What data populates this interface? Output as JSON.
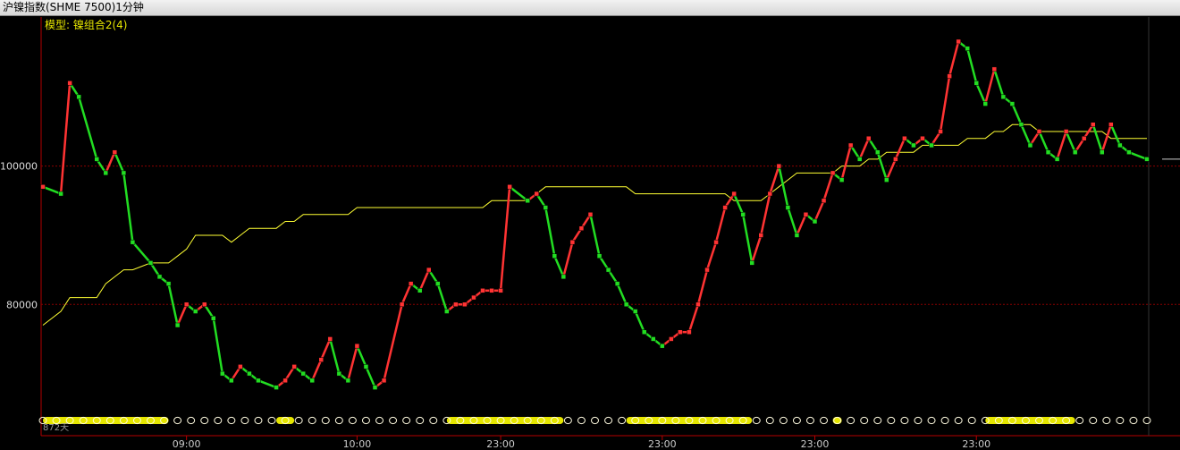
{
  "window": {
    "title": "沪镍指数(SHME 7500)1分钟"
  },
  "model_label": "模型: 镍组合2(4)",
  "colors": {
    "price": "#c8c8c8",
    "avg": "#ffff33",
    "up": "#ff3333",
    "down": "#22dd22",
    "gridline": "#8b0000",
    "axis": "#b40000",
    "signal": "#e6e600"
  },
  "chart_data": {
    "type": "line",
    "title": "沪镍指数(SHME 7500)1分钟",
    "ylim": [
      64000,
      120000
    ],
    "yticks": [
      80000,
      100000
    ],
    "ytick_labels": [
      "80000",
      "100000"
    ],
    "xticks": [
      16,
      35,
      51,
      69,
      86,
      104
    ],
    "xtick_labels": [
      "09:00",
      "10:00",
      "23:00",
      "23:00",
      "23:00",
      "23:00"
    ],
    "x": [
      0,
      2,
      3,
      4,
      6,
      7,
      8,
      9,
      10,
      12,
      13,
      14,
      15,
      16,
      17,
      18,
      19,
      20,
      21,
      22,
      23,
      24,
      26,
      27,
      28,
      29,
      30,
      31,
      32,
      33,
      34,
      35,
      36,
      37,
      38,
      40,
      41,
      42,
      43,
      44,
      45,
      46,
      47,
      48,
      49,
      50,
      51,
      52,
      54,
      55,
      56,
      57,
      58,
      59,
      60,
      61,
      62,
      63,
      64,
      65,
      66,
      67,
      68,
      69,
      70,
      71,
      72,
      73,
      74,
      75,
      76,
      77,
      78,
      79,
      80,
      81,
      82,
      83,
      84,
      85,
      86,
      87,
      88,
      89,
      90,
      91,
      92,
      93,
      94,
      95,
      96,
      97,
      98,
      99,
      100,
      101,
      102,
      103,
      104,
      105,
      106,
      107,
      108,
      109,
      110,
      111,
      112,
      113,
      114,
      115,
      116,
      117,
      118,
      119,
      120,
      121,
      123
    ],
    "series": [
      {
        "name": "",
        "values": [
          97000,
          96000,
          112000,
          110000,
          101000,
          99000,
          102000,
          99000,
          89000,
          86000,
          84000,
          83000,
          77000,
          80000,
          79000,
          80000,
          78000,
          70000,
          69000,
          71000,
          70000,
          69000,
          68000,
          69000,
          71000,
          70000,
          69000,
          72000,
          75000,
          70000,
          69000,
          74000,
          71000,
          68000,
          69000,
          80000,
          83000,
          82000,
          85000,
          83000,
          79000,
          80000,
          80000,
          81000,
          82000,
          82000,
          82000,
          97000,
          95000,
          96000,
          94000,
          87000,
          84000,
          89000,
          91000,
          93000,
          87000,
          85000,
          83000,
          80000,
          79000,
          76000,
          75000,
          74000,
          75000,
          76000,
          76000,
          80000,
          85000,
          89000,
          94000,
          96000,
          93000,
          86000,
          90000,
          96000,
          100000,
          94000,
          90000,
          93000,
          92000,
          95000,
          99000,
          98000,
          103000,
          101000,
          104000,
          102000,
          98000,
          101000,
          104000,
          103000,
          104000,
          103000,
          105000,
          113000,
          118000,
          117000,
          112000,
          109000,
          114000,
          110000,
          109000,
          106000,
          103000,
          105000,
          102000,
          101000,
          105000,
          102000,
          104000,
          106000,
          102000,
          106000,
          103000,
          102000,
          101000
        ]
      },
      {
        "name": "",
        "values": [
          77000,
          79000,
          81000,
          81000,
          81000,
          83000,
          84000,
          85000,
          85000,
          86000,
          86000,
          86000,
          87000,
          88000,
          90000,
          90000,
          90000,
          90000,
          89000,
          90000,
          91000,
          91000,
          91000,
          92000,
          92000,
          93000,
          93000,
          93000,
          93000,
          93000,
          93000,
          94000,
          94000,
          94000,
          94000,
          94000,
          94000,
          94000,
          94000,
          94000,
          94000,
          94000,
          94000,
          94000,
          94000,
          95000,
          95000,
          95000,
          95000,
          96000,
          97000,
          97000,
          97000,
          97000,
          97000,
          97000,
          97000,
          97000,
          97000,
          97000,
          96000,
          96000,
          96000,
          96000,
          96000,
          96000,
          96000,
          96000,
          96000,
          96000,
          96000,
          95000,
          95000,
          95000,
          95000,
          96000,
          97000,
          98000,
          99000,
          99000,
          99000,
          99000,
          99000,
          100000,
          100000,
          100000,
          101000,
          101000,
          102000,
          102000,
          102000,
          102000,
          103000,
          103000,
          103000,
          103000,
          103000,
          104000,
          104000,
          104000,
          105000,
          105000,
          106000,
          106000,
          106000,
          105000,
          105000,
          105000,
          105000,
          105000,
          105000,
          105000,
          105000,
          104000,
          104000,
          104000,
          104000
        ]
      }
    ],
    "signal_row_label": "872天"
  }
}
